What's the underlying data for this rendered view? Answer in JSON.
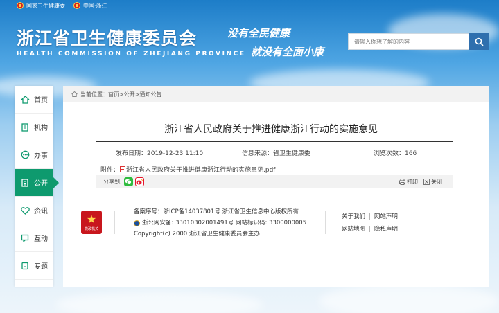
{
  "topbar": {
    "nhc": "国家卫生健康委",
    "zj": "中国·浙江"
  },
  "header": {
    "title": "浙江省卫生健康委员会",
    "subtitle": "HEALTH COMMISSION OF ZHEJIANG PROVINCE",
    "slogan_line1": "没有全民健康",
    "slogan_line2": "就没有全面小康",
    "search_placeholder": "请输入你想了解的内容"
  },
  "sidebar": {
    "items": [
      {
        "label": "首页",
        "icon": "home-icon"
      },
      {
        "label": "机构",
        "icon": "building-icon"
      },
      {
        "label": "办事",
        "icon": "service-icon"
      },
      {
        "label": "公开",
        "icon": "document-icon",
        "active": true
      },
      {
        "label": "资讯",
        "icon": "heart-icon"
      },
      {
        "label": "互动",
        "icon": "chat-icon"
      },
      {
        "label": "专题",
        "icon": "book-icon"
      }
    ]
  },
  "breadcrumb": {
    "prefix": "当前位置：",
    "home": "首页",
    "sep1": ">",
    "level1": "公开",
    "sep2": ">",
    "level2": "通知公告"
  },
  "article": {
    "title": "浙江省人民政府关于推进健康浙江行动的实施意见",
    "date_label": "发布日期：",
    "date": "2019-12-23 11:10",
    "source_label": "信息来源：",
    "source": "省卫生健康委",
    "views_label": "浏览次数：",
    "views": "166",
    "attach_label": "附件：",
    "attach_file": "浙江省人民政府关于推进健康浙江行动的实施意见.pdf"
  },
  "share": {
    "label": "分享到:",
    "print": "打印",
    "close": "关闭",
    "colors": {
      "wechat": "#2dbb3d",
      "weibo": "#e6162d"
    }
  },
  "footer": {
    "logo_text": "党政机关",
    "icp": "备案序号：浙ICP备14037801号  浙江省卫生信息中心版权所有",
    "police": "浙公网安备: 33010302001491号 网站标识码: 3300000005",
    "copyright": "Copyright(c) 2000 浙江省卫生健康委员会主办",
    "link_about": "关于我们",
    "link_statement": "网站声明",
    "link_map": "网站地图",
    "link_privacy": "隐私声明",
    "link_sep": "|"
  },
  "colors": {
    "accent_green": "#0e9a6e",
    "search_blue": "#2f6fae",
    "party_red": "#c8161d"
  }
}
